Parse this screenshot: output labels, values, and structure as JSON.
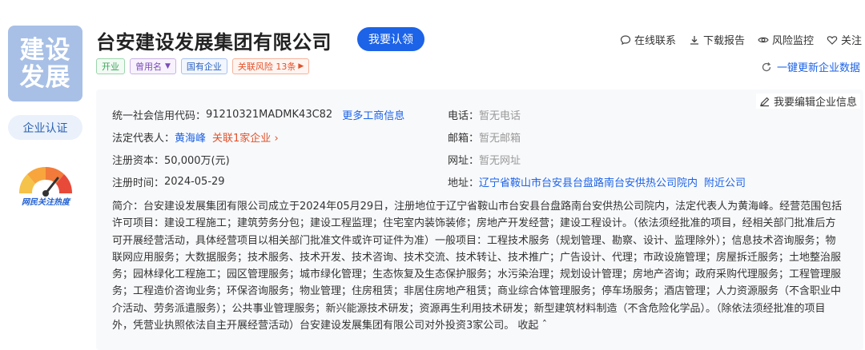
{
  "logo": {
    "line1": "建设",
    "line2": "发展",
    "bg": "#a8c0e6"
  },
  "sidebar": {
    "cert_label": "企业认证",
    "heat_label": "网民关注热度"
  },
  "company": {
    "name": "台安建设发展集团有限公司",
    "claim_label": "我要认领"
  },
  "actions": [
    {
      "icon": "chat-icon",
      "label": "在线联系"
    },
    {
      "icon": "download-icon",
      "label": "下载报告"
    },
    {
      "icon": "eye-icon",
      "label": "风险监控"
    },
    {
      "icon": "heart-icon",
      "label": "关注"
    }
  ],
  "tags": {
    "status": "开业",
    "former_name": "曾用名",
    "ownership": "国有企业",
    "risk": "关联风险 13条"
  },
  "refresh_label": "一键更新企业数据",
  "edit_label": "我要编辑企业信息",
  "info": {
    "credit_code_label": "统一社会信用代码：",
    "credit_code": "91210321MADMK43C82",
    "more_info": "更多工商信息",
    "legal_rep_label": "法定代表人：",
    "legal_rep": "黄海峰",
    "related_companies": "关联1家企业",
    "capital_label": "注册资本：",
    "capital": "50,000万(元)",
    "reg_date_label": "注册时间：",
    "reg_date": "2024-05-29",
    "phone_label": "电话：",
    "phone": "暂无电话",
    "email_label": "邮箱：",
    "email": "暂无邮箱",
    "website_label": "网址：",
    "website": "暂无网址",
    "address_label": "地址：",
    "address": "辽宁省鞍山市台安县台盘路南台安供热公司院内",
    "nearby": "附近公司"
  },
  "intro": {
    "text": "简介：台安建设发展集团有限公司成立于2024年05月29日，注册地位于辽宁省鞍山市台安县台盘路南台安供热公司院内，法定代表人为黄海峰。经营范围包括许可项目：建设工程施工；建筑劳务分包；建设工程监理；住宅室内装饰装修；房地产开发经营；建设工程设计。（依法须经批准的项目，经相关部门批准后方可开展经营活动，具体经营项目以相关部门批准文件或许可证件为准）一般项目：工程技术服务（规划管理、勘察、设计、监理除外）；信息技术咨询服务；物联网应用服务；大数据服务；技术服务、技术开发、技术咨询、技术交流、技术转让、技术推广；广告设计、代理；市政设施管理；房屋拆迁服务；土地整治服务；园林绿化工程施工；园区管理服务；城市绿化管理；生态恢复及生态保护服务；水污染治理；规划设计管理；房地产咨询；政府采购代理服务；工程管理服务；工程造价咨询业务；环保咨询服务；物业管理；住房租赁；非居住房地产租赁；商业综合体管理服务；停车场服务；酒店管理；人力资源服务（不含职业中介活动、劳务派遣服务）；公共事业管理服务；新兴能源技术研发；资源再生利用技术研发；新型建筑材料制造（不含危险化学品）。（除依法须经批准的项目外，凭营业执照依法自主开展经营活动）台安建设发展集团有限公司对外投资3家公司。",
    "collapse_label": "收起"
  }
}
